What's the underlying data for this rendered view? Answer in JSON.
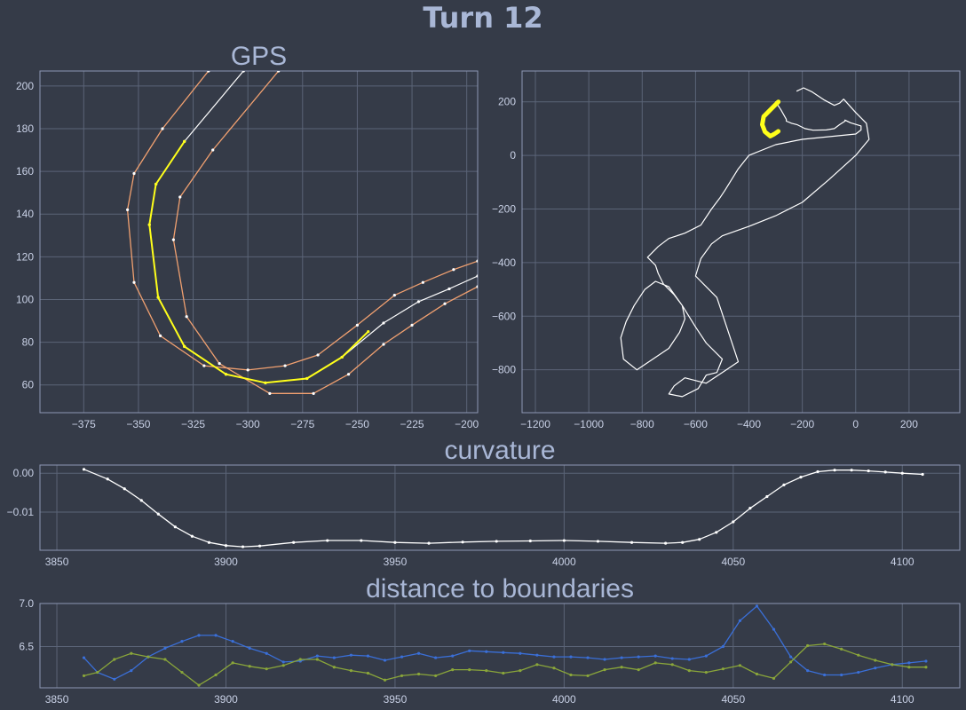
{
  "title": "Turn 12",
  "chart_data": [
    {
      "type": "line",
      "title": "GPS",
      "xlim": [
        -395,
        -195
      ],
      "ylim": [
        47,
        207
      ],
      "xticks": [
        -375,
        -350,
        -325,
        -300,
        -275,
        -250,
        -225,
        -200
      ],
      "yticks": [
        60,
        80,
        100,
        120,
        140,
        160,
        180,
        200
      ],
      "tick_labels_x": [
        "−375",
        "−350",
        "−325",
        "−300",
        "−275",
        "−250",
        "−225",
        "−200"
      ],
      "tick_labels_y": [
        "60",
        "80",
        "100",
        "120",
        "140",
        "160",
        "180",
        "200"
      ],
      "colors": {
        "boundary": "#f0a070",
        "centerline": "#ffffff",
        "highlight": "#ffff1a"
      },
      "series": [
        {
          "role": "left-boundary",
          "x": [
            -318,
            -339,
            -352,
            -355,
            -352,
            -340,
            -320,
            -300,
            -283,
            -268,
            -250,
            -233,
            -220,
            -206,
            -195
          ],
          "y": [
            207,
            180,
            159,
            142,
            108,
            83,
            69,
            67,
            69,
            74,
            88,
            102,
            108,
            114,
            118
          ]
        },
        {
          "role": "centerline",
          "x": [
            -302,
            -329,
            -342,
            -345,
            -341,
            -329,
            -310,
            -292,
            -273,
            -257,
            -238,
            -222,
            -208,
            -195
          ],
          "y": [
            207,
            174,
            154,
            135,
            101,
            78,
            65,
            61,
            63,
            73,
            89,
            99,
            105,
            111
          ]
        },
        {
          "role": "right-boundary",
          "x": [
            -286,
            -316,
            -331,
            -334,
            -328,
            -313,
            -290,
            -270,
            -254,
            -238,
            -225,
            -210,
            -195
          ],
          "y": [
            207,
            170,
            148,
            128,
            92,
            70,
            56,
            56,
            65,
            79,
            88,
            98,
            106
          ]
        },
        {
          "role": "turn-segment",
          "x": [
            -329,
            -342,
            -345,
            -341,
            -329,
            -310,
            -292,
            -273,
            -257,
            -245
          ],
          "y": [
            174,
            154,
            135,
            101,
            78,
            65,
            61,
            63,
            73,
            85
          ]
        }
      ]
    },
    {
      "type": "line",
      "title": "",
      "xlim": [
        -1250,
        390
      ],
      "ylim": [
        -960,
        315
      ],
      "xticks": [
        -1200,
        -1000,
        -800,
        -600,
        -400,
        -200,
        0,
        200
      ],
      "yticks": [
        -800,
        -600,
        -400,
        -200,
        0,
        200
      ],
      "tick_labels_x": [
        "−1200",
        "−1000",
        "−800",
        "−600",
        "−400",
        "−200",
        "0",
        "200"
      ],
      "tick_labels_y": [
        "−800",
        "−600",
        "−400",
        "−200",
        "0",
        "200"
      ],
      "series": [
        {
          "role": "track",
          "x": [
            -220,
            -195,
            -165,
            -120,
            -80,
            -60,
            -45,
            0,
            40,
            50,
            0,
            -100,
            -200,
            -300,
            -400,
            -500,
            -540,
            -580,
            -600,
            -560,
            -520,
            -440,
            -500,
            -560,
            -600,
            -640,
            -680,
            -700,
            -650,
            -590,
            -560,
            -520,
            -500,
            -560,
            -600,
            -650,
            -700,
            -750,
            -790,
            -830,
            -860,
            -880,
            -870,
            -820,
            -760,
            -700,
            -660,
            -640,
            -650,
            -680,
            -720,
            -740,
            -750,
            -780,
            -740,
            -700,
            -640,
            -580,
            -540,
            -510,
            -490,
            -440,
            -400,
            -300,
            -200,
            -100,
            0,
            20,
            20,
            -20,
            -40,
            -40,
            -60,
            -80,
            -110,
            -160,
            -190,
            -200,
            -210,
            -220,
            -240,
            -260,
            -260,
            -280,
            -300
          ],
          "y": [
            240,
            252,
            238,
            208,
            187,
            195,
            210,
            160,
            120,
            60,
            0,
            -90,
            -175,
            -225,
            -265,
            -300,
            -330,
            -385,
            -450,
            -490,
            -530,
            -770,
            -810,
            -850,
            -840,
            -830,
            -860,
            -890,
            -900,
            -870,
            -820,
            -810,
            -760,
            -700,
            -640,
            -560,
            -490,
            -470,
            -500,
            -560,
            -620,
            -680,
            -760,
            -800,
            -760,
            -720,
            -660,
            -610,
            -560,
            -520,
            -480,
            -440,
            -410,
            -380,
            -340,
            -310,
            -290,
            -260,
            -200,
            -160,
            -130,
            -50,
            0,
            40,
            60,
            70,
            80,
            95,
            110,
            122,
            132,
            128,
            115,
            100,
            95,
            94,
            100,
            105,
            110,
            115,
            120,
            128,
            135,
            170,
            200
          ]
        },
        {
          "role": "turn-segment",
          "x": [
            -290,
            -320,
            -345,
            -350,
            -340,
            -320,
            -305,
            -290
          ],
          "y": [
            200,
            170,
            145,
            115,
            88,
            72,
            80,
            90
          ]
        }
      ]
    },
    {
      "type": "line",
      "title": "curvature",
      "xlim": [
        3845,
        4117
      ],
      "ylim": [
        -0.0198,
        0.0021
      ],
      "xticks": [
        3850,
        3900,
        3950,
        4000,
        4050,
        4100
      ],
      "yticks": [
        0.0,
        -0.01
      ],
      "tick_labels_x": [
        "3850",
        "3900",
        "3950",
        "4000",
        "4050",
        "4100"
      ],
      "tick_labels_y": [
        "0.00",
        "−0.01"
      ],
      "series": [
        {
          "x": [
            3858,
            3865,
            3870,
            3875,
            3880,
            3885,
            3890,
            3895,
            3900,
            3905,
            3910,
            3920,
            3930,
            3940,
            3950,
            3960,
            3970,
            3980,
            3990,
            4000,
            4010,
            4020,
            4030,
            4035,
            4040,
            4045,
            4050,
            4055,
            4060,
            4065,
            4070,
            4075,
            4080,
            4085,
            4090,
            4095,
            4100,
            4106
          ],
          "y": [
            0.001,
            -0.0015,
            -0.004,
            -0.007,
            -0.0105,
            -0.0138,
            -0.0162,
            -0.0178,
            -0.0186,
            -0.0189,
            -0.0187,
            -0.0178,
            -0.0173,
            -0.0173,
            -0.0178,
            -0.018,
            -0.0177,
            -0.0175,
            -0.0174,
            -0.0173,
            -0.0175,
            -0.0178,
            -0.018,
            -0.0178,
            -0.017,
            -0.0152,
            -0.0125,
            -0.009,
            -0.006,
            -0.003,
            -0.001,
            0.0004,
            0.0008,
            0.0008,
            0.0006,
            0.0003,
            0.0,
            -0.0003
          ]
        }
      ]
    },
    {
      "type": "line",
      "title": "distance to boundaries",
      "xlim": [
        3845,
        4117
      ],
      "ylim": [
        6.02,
        7.0
      ],
      "xticks": [
        3850,
        3900,
        3950,
        4000,
        4050,
        4100
      ],
      "yticks": [
        7.0,
        6.5
      ],
      "tick_labels_x": [
        "3850",
        "3900",
        "3950",
        "4000",
        "4050",
        "4100"
      ],
      "tick_labels_y": [
        "7.0",
        "6.5"
      ],
      "series": [
        {
          "color": "#3a6fd8",
          "x": [
            3858,
            3862,
            3867,
            3872,
            3877,
            3882,
            3887,
            3892,
            3897,
            3902,
            3907,
            3912,
            3917,
            3922,
            3927,
            3932,
            3937,
            3942,
            3947,
            3952,
            3957,
            3962,
            3967,
            3972,
            3977,
            3982,
            3987,
            3992,
            3997,
            4002,
            4007,
            4012,
            4017,
            4022,
            4027,
            4032,
            4037,
            4042,
            4047,
            4052,
            4057,
            4062,
            4067,
            4072,
            4077,
            4082,
            4087,
            4092,
            4097,
            4102,
            4107
          ],
          "y": [
            6.37,
            6.2,
            6.12,
            6.22,
            6.38,
            6.48,
            6.56,
            6.63,
            6.63,
            6.56,
            6.48,
            6.42,
            6.32,
            6.33,
            6.39,
            6.37,
            6.4,
            6.39,
            6.34,
            6.38,
            6.42,
            6.37,
            6.39,
            6.45,
            6.44,
            6.43,
            6.42,
            6.4,
            6.38,
            6.38,
            6.37,
            6.35,
            6.37,
            6.38,
            6.39,
            6.36,
            6.35,
            6.39,
            6.5,
            6.8,
            6.97,
            6.7,
            6.38,
            6.22,
            6.17,
            6.17,
            6.2,
            6.25,
            6.29,
            6.31,
            6.33
          ]
        },
        {
          "color": "#8aa63a",
          "x": [
            3858,
            3862,
            3867,
            3872,
            3877,
            3882,
            3887,
            3892,
            3897,
            3902,
            3907,
            3912,
            3917,
            3922,
            3927,
            3932,
            3937,
            3942,
            3947,
            3952,
            3957,
            3962,
            3967,
            3972,
            3977,
            3982,
            3987,
            3992,
            3997,
            4002,
            4007,
            4012,
            4017,
            4022,
            4027,
            4032,
            4037,
            4042,
            4047,
            4052,
            4057,
            4062,
            4067,
            4072,
            4077,
            4082,
            4087,
            4092,
            4097,
            4102,
            4107
          ],
          "y": [
            6.16,
            6.2,
            6.35,
            6.42,
            6.38,
            6.35,
            6.2,
            6.05,
            6.17,
            6.31,
            6.27,
            6.24,
            6.28,
            6.35,
            6.35,
            6.26,
            6.22,
            6.19,
            6.11,
            6.16,
            6.18,
            6.16,
            6.23,
            6.23,
            6.22,
            6.19,
            6.22,
            6.29,
            6.25,
            6.17,
            6.16,
            6.23,
            6.26,
            6.23,
            6.31,
            6.29,
            6.22,
            6.2,
            6.24,
            6.28,
            6.18,
            6.13,
            6.32,
            6.51,
            6.53,
            6.47,
            6.4,
            6.34,
            6.29,
            6.26,
            6.26
          ]
        }
      ]
    }
  ]
}
